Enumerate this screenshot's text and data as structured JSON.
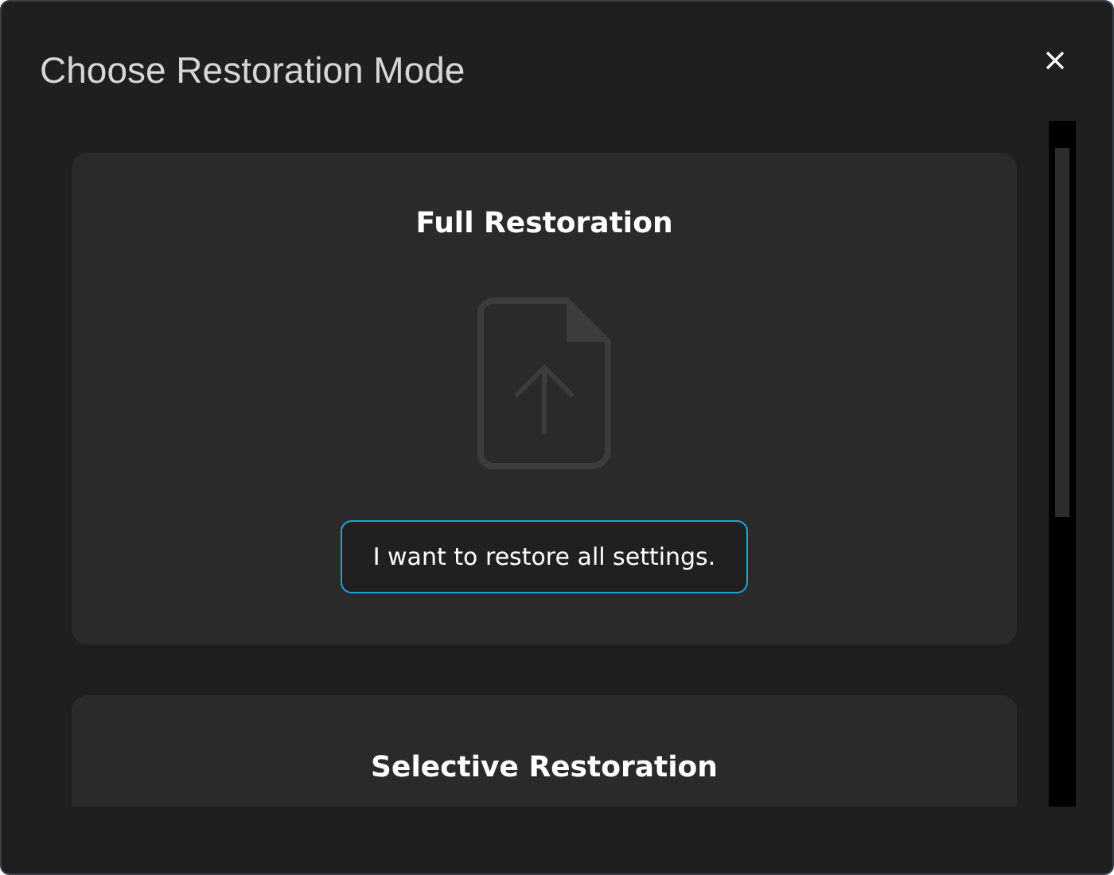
{
  "dialog": {
    "title": "Choose Restoration Mode"
  },
  "options": [
    {
      "title": "Full Restoration",
      "button": "I want to restore all settings."
    },
    {
      "title": "Selective Restoration"
    }
  ]
}
